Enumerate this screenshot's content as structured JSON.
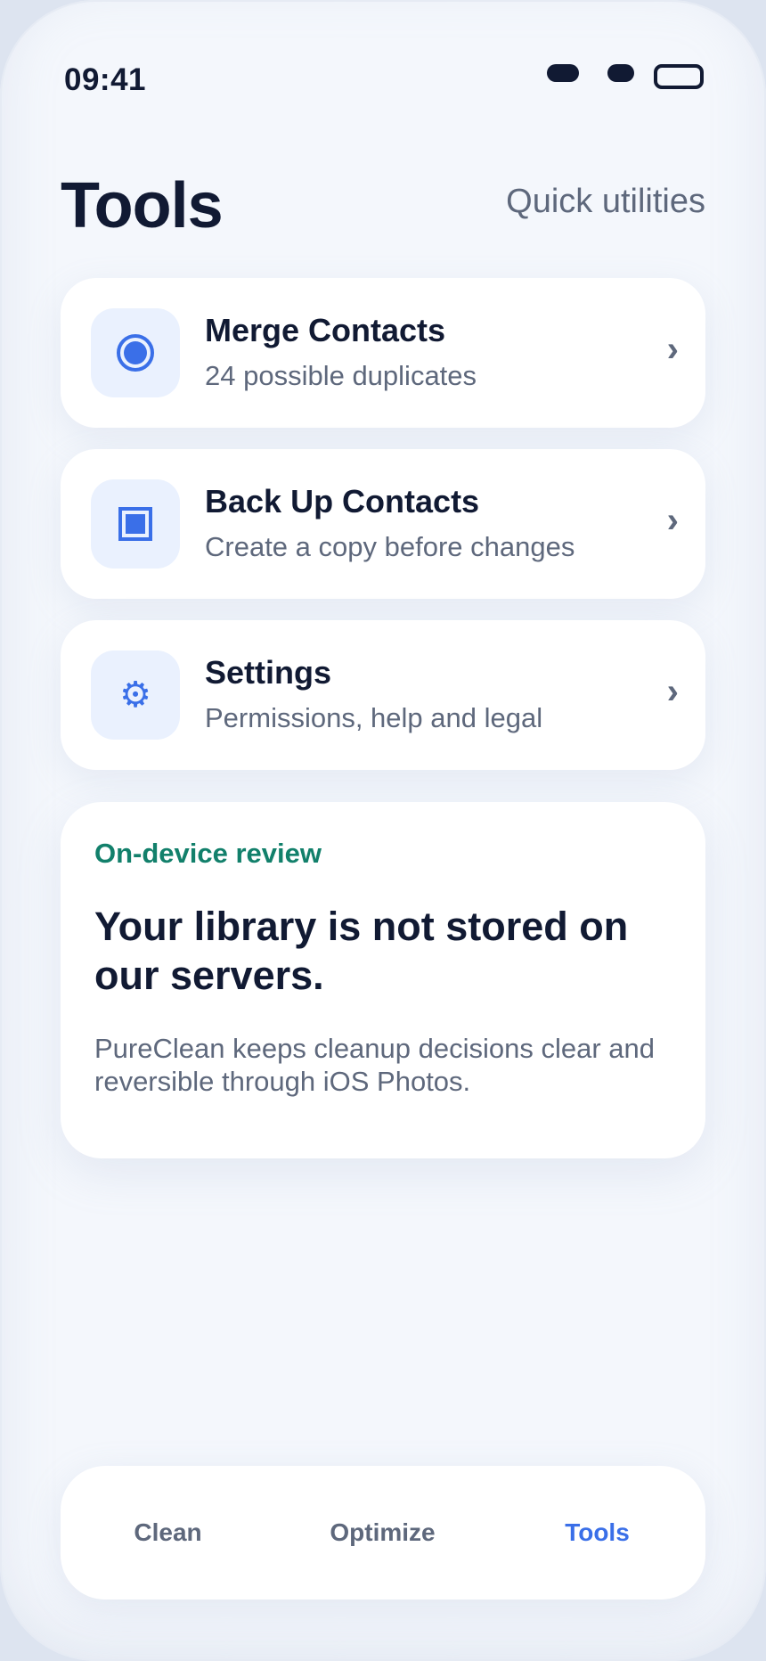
{
  "status_bar": {
    "time": "09:41"
  },
  "header": {
    "title": "Tools",
    "subtitle": "Quick utilities"
  },
  "tools": [
    {
      "title": "Merge Contacts",
      "description": "24 possible duplicates",
      "icon": "radio-dot-icon"
    },
    {
      "title": "Back Up Contacts",
      "description": "Create a copy before changes",
      "icon": "square-stop-icon"
    },
    {
      "title": "Settings",
      "description": "Permissions, help and legal",
      "icon": "gear-icon"
    }
  ],
  "chevron_glyph": "›",
  "gear_glyph": "⚙",
  "info": {
    "eyebrow": "On-device review",
    "headline": "Your library is not stored on our servers.",
    "body": "PureClean keeps cleanup decisions clear and reversible through iOS Photos."
  },
  "tabs": [
    {
      "label": "Clean",
      "active": false
    },
    {
      "label": "Optimize",
      "active": false
    },
    {
      "label": "Tools",
      "active": true
    }
  ],
  "colors": {
    "accent": "#3a6fe8",
    "teal": "#12806b",
    "text_primary": "#111a33",
    "text_secondary": "#5e687c",
    "icon_tile": "#eaf1fe"
  }
}
